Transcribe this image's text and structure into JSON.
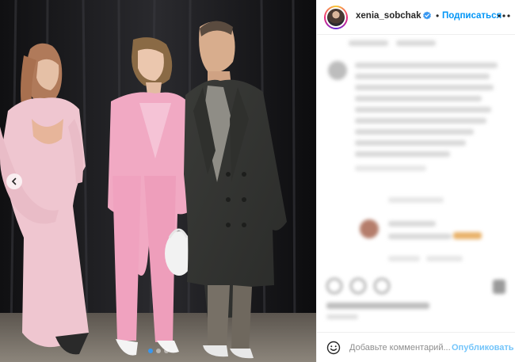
{
  "header": {
    "username": "xenia_sobchak",
    "separator": "•",
    "follow_label": "Подписаться",
    "verified_icon": "verified-badge-icon",
    "more_icon": "more-options-icon"
  },
  "carousel": {
    "prev_icon": "chevron-left-icon",
    "slide_count": 3,
    "active_slide": 1
  },
  "comment_box": {
    "placeholder": "Добавьте комментарий...",
    "publish_label": "Опубликовать",
    "emoji_icon": "emoji-icon"
  },
  "colors": {
    "accent": "#0095f6",
    "active_dot": "#3797f0",
    "username": "#262626",
    "border": "#efefef"
  }
}
